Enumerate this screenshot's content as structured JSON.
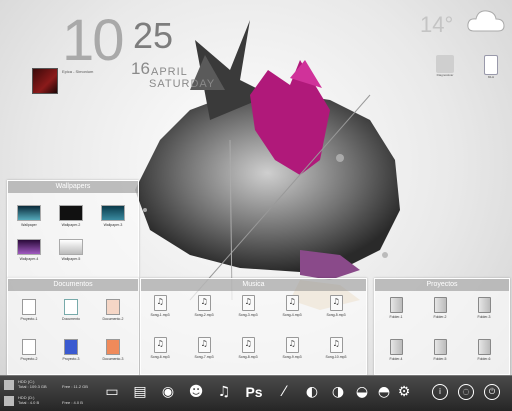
{
  "clock": {
    "hour": "10",
    "minute": "25",
    "day": "16",
    "month": "APRIL",
    "weekday": "SATURDAY"
  },
  "media": {
    "artist": "Epica - Simonium",
    "sub": "Simonium"
  },
  "weather": {
    "temp": "14°",
    "icon": "cloud-icon"
  },
  "desktop_icons": [
    {
      "label": "Diagnosticar",
      "icon": "shortcut-icon"
    },
    {
      "label": "MLH",
      "icon": "file-icon"
    }
  ],
  "fences": {
    "wallpapers": {
      "title": "Wallpapers",
      "items": [
        "Wallpaper",
        "Wallpaper-2",
        "Wallpaper-3",
        "Wallpaper-4",
        "Wallpaper-5"
      ]
    },
    "documentos": {
      "title": "Documentos",
      "items": [
        "Proyecto-1",
        "Documento",
        "Documento-2",
        "Proyecto-2",
        "Proyecto-3",
        "Documento-3"
      ]
    },
    "musica": {
      "title": "Musica",
      "items": [
        "Song-1.mp3",
        "Song-2.mp3",
        "Song-3.mp3",
        "Song-4.mp3",
        "Song-5.mp3",
        "Song-6.mp3",
        "Song-7.mp3",
        "Song-8.mp3",
        "Song-9.mp3",
        "Song-10.mp3"
      ]
    },
    "proyectos": {
      "title": "Proyectos",
      "items": [
        "Folder-1",
        "Folder-2",
        "Folder-3",
        "Folder-4",
        "Folder-5",
        "Folder-6"
      ]
    }
  },
  "taskbar": {
    "drive_c": {
      "name": "HDD (C:)",
      "total": "Total : 109.3 GB",
      "free": "Free : 11.2 GB"
    },
    "drive_d": {
      "name": "HDD (D:)",
      "total": "Total : 4.0 B",
      "free": "Free : 4.0 B"
    },
    "launcher_icons": [
      "monitor-icon",
      "folder-icon",
      "chrome-icon",
      "users-icon",
      "music-icon",
      "photoshop-icon",
      "brush-icon",
      "app-icon",
      "app-icon-2",
      "app-icon-3",
      "app-icon-4",
      "tool-icon"
    ],
    "ps_label": "Ps",
    "power_icons": [
      "info-icon",
      "power-icon",
      "shutdown-icon"
    ]
  }
}
